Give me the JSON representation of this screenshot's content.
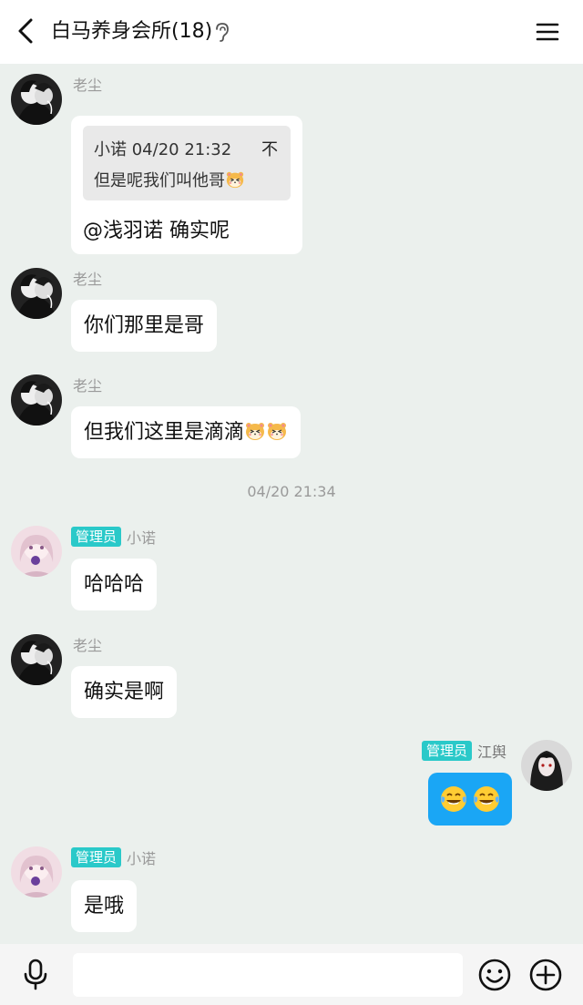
{
  "header": {
    "title": "白马养身会所(18)",
    "back_icon": "chevron-left-icon",
    "ear_icon": "ear-icon",
    "menu_icon": "hamburger-menu-icon"
  },
  "messages": [
    {
      "sender": "老尘",
      "quote": {
        "meta": "小诺 04/20 21:32",
        "pin": "不",
        "text": "但是呢我们叫他哥"
      },
      "reply": "@浅羽诺 确实呢"
    },
    {
      "sender": "老尘",
      "text": "你们那里是哥"
    },
    {
      "sender": "老尘",
      "text": "但我们这里是滴滴"
    },
    {
      "timestamp": "04/20 21:34"
    },
    {
      "badge": "管理员",
      "sender": "小诺",
      "text": "哈哈哈"
    },
    {
      "sender": "老尘",
      "text": "确实是啊"
    },
    {
      "badge": "管理员",
      "sender": "江舆",
      "self": true
    },
    {
      "badge": "管理员",
      "sender": "小诺",
      "text": "是哦"
    }
  ],
  "input": {
    "placeholder": "",
    "value": ""
  },
  "colors": {
    "background": "#ebf0ed",
    "badge": "#2ac9c9",
    "self_bubble": "#1aa6f5",
    "timestamp": "#9a9a9a"
  }
}
